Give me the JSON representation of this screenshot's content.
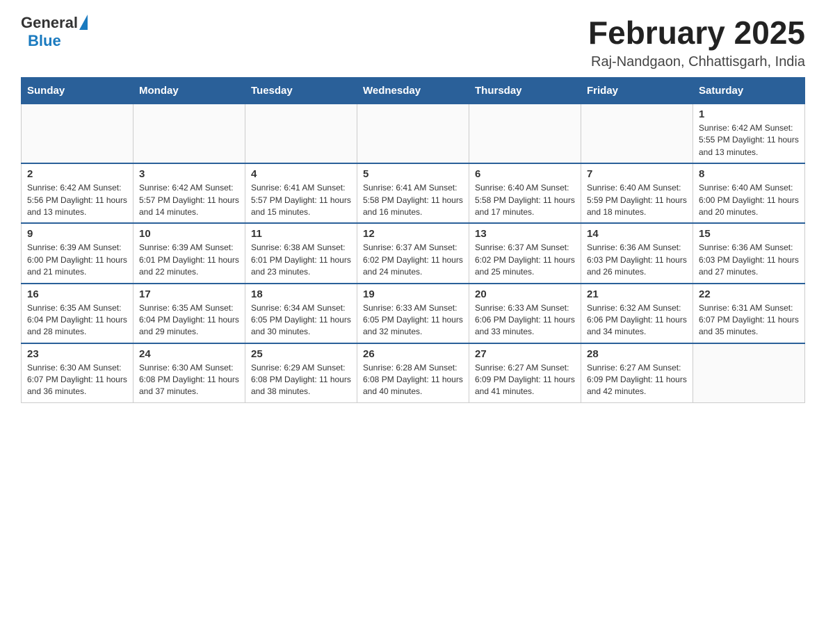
{
  "header": {
    "logo": {
      "general": "General",
      "blue": "Blue"
    },
    "title": "February 2025",
    "location": "Raj-Nandgaon, Chhattisgarh, India"
  },
  "days_of_week": [
    "Sunday",
    "Monday",
    "Tuesday",
    "Wednesday",
    "Thursday",
    "Friday",
    "Saturday"
  ],
  "weeks": [
    {
      "days": [
        {
          "date": "",
          "info": ""
        },
        {
          "date": "",
          "info": ""
        },
        {
          "date": "",
          "info": ""
        },
        {
          "date": "",
          "info": ""
        },
        {
          "date": "",
          "info": ""
        },
        {
          "date": "",
          "info": ""
        },
        {
          "date": "1",
          "info": "Sunrise: 6:42 AM\nSunset: 5:55 PM\nDaylight: 11 hours and 13 minutes."
        }
      ]
    },
    {
      "days": [
        {
          "date": "2",
          "info": "Sunrise: 6:42 AM\nSunset: 5:56 PM\nDaylight: 11 hours and 13 minutes."
        },
        {
          "date": "3",
          "info": "Sunrise: 6:42 AM\nSunset: 5:57 PM\nDaylight: 11 hours and 14 minutes."
        },
        {
          "date": "4",
          "info": "Sunrise: 6:41 AM\nSunset: 5:57 PM\nDaylight: 11 hours and 15 minutes."
        },
        {
          "date": "5",
          "info": "Sunrise: 6:41 AM\nSunset: 5:58 PM\nDaylight: 11 hours and 16 minutes."
        },
        {
          "date": "6",
          "info": "Sunrise: 6:40 AM\nSunset: 5:58 PM\nDaylight: 11 hours and 17 minutes."
        },
        {
          "date": "7",
          "info": "Sunrise: 6:40 AM\nSunset: 5:59 PM\nDaylight: 11 hours and 18 minutes."
        },
        {
          "date": "8",
          "info": "Sunrise: 6:40 AM\nSunset: 6:00 PM\nDaylight: 11 hours and 20 minutes."
        }
      ]
    },
    {
      "days": [
        {
          "date": "9",
          "info": "Sunrise: 6:39 AM\nSunset: 6:00 PM\nDaylight: 11 hours and 21 minutes."
        },
        {
          "date": "10",
          "info": "Sunrise: 6:39 AM\nSunset: 6:01 PM\nDaylight: 11 hours and 22 minutes."
        },
        {
          "date": "11",
          "info": "Sunrise: 6:38 AM\nSunset: 6:01 PM\nDaylight: 11 hours and 23 minutes."
        },
        {
          "date": "12",
          "info": "Sunrise: 6:37 AM\nSunset: 6:02 PM\nDaylight: 11 hours and 24 minutes."
        },
        {
          "date": "13",
          "info": "Sunrise: 6:37 AM\nSunset: 6:02 PM\nDaylight: 11 hours and 25 minutes."
        },
        {
          "date": "14",
          "info": "Sunrise: 6:36 AM\nSunset: 6:03 PM\nDaylight: 11 hours and 26 minutes."
        },
        {
          "date": "15",
          "info": "Sunrise: 6:36 AM\nSunset: 6:03 PM\nDaylight: 11 hours and 27 minutes."
        }
      ]
    },
    {
      "days": [
        {
          "date": "16",
          "info": "Sunrise: 6:35 AM\nSunset: 6:04 PM\nDaylight: 11 hours and 28 minutes."
        },
        {
          "date": "17",
          "info": "Sunrise: 6:35 AM\nSunset: 6:04 PM\nDaylight: 11 hours and 29 minutes."
        },
        {
          "date": "18",
          "info": "Sunrise: 6:34 AM\nSunset: 6:05 PM\nDaylight: 11 hours and 30 minutes."
        },
        {
          "date": "19",
          "info": "Sunrise: 6:33 AM\nSunset: 6:05 PM\nDaylight: 11 hours and 32 minutes."
        },
        {
          "date": "20",
          "info": "Sunrise: 6:33 AM\nSunset: 6:06 PM\nDaylight: 11 hours and 33 minutes."
        },
        {
          "date": "21",
          "info": "Sunrise: 6:32 AM\nSunset: 6:06 PM\nDaylight: 11 hours and 34 minutes."
        },
        {
          "date": "22",
          "info": "Sunrise: 6:31 AM\nSunset: 6:07 PM\nDaylight: 11 hours and 35 minutes."
        }
      ]
    },
    {
      "days": [
        {
          "date": "23",
          "info": "Sunrise: 6:30 AM\nSunset: 6:07 PM\nDaylight: 11 hours and 36 minutes."
        },
        {
          "date": "24",
          "info": "Sunrise: 6:30 AM\nSunset: 6:08 PM\nDaylight: 11 hours and 37 minutes."
        },
        {
          "date": "25",
          "info": "Sunrise: 6:29 AM\nSunset: 6:08 PM\nDaylight: 11 hours and 38 minutes."
        },
        {
          "date": "26",
          "info": "Sunrise: 6:28 AM\nSunset: 6:08 PM\nDaylight: 11 hours and 40 minutes."
        },
        {
          "date": "27",
          "info": "Sunrise: 6:27 AM\nSunset: 6:09 PM\nDaylight: 11 hours and 41 minutes."
        },
        {
          "date": "28",
          "info": "Sunrise: 6:27 AM\nSunset: 6:09 PM\nDaylight: 11 hours and 42 minutes."
        },
        {
          "date": "",
          "info": ""
        }
      ]
    }
  ]
}
